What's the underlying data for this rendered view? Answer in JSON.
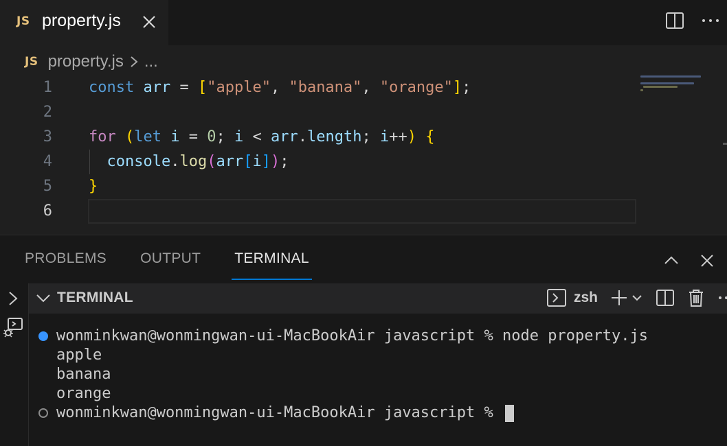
{
  "tab": {
    "badge": "JS",
    "title": "property.js"
  },
  "breadcrumb": {
    "badge": "JS",
    "file": "property.js",
    "more": "..."
  },
  "editor": {
    "line_numbers": [
      "1",
      "2",
      "3",
      "4",
      "5",
      "6"
    ],
    "line1": {
      "kw": "const",
      "var": "arr",
      "eq": " = ",
      "open": "[",
      "s1": "\"apple\"",
      "c1": ", ",
      "s2": "\"banana\"",
      "c2": ", ",
      "s3": "\"orange\"",
      "close": "]",
      "semi": ";"
    },
    "line3": {
      "kw": "for",
      "p_open": "(",
      "let": "let",
      "i1": "i",
      "eq": " = ",
      "zero": "0",
      "semi1": "; ",
      "i2": "i",
      "lt": " < ",
      "arr": "arr",
      "dot": ".",
      "length": "length",
      "semi2": "; ",
      "i3": "i",
      "inc": "++",
      "p_close": ")",
      "brace": "{"
    },
    "line4": {
      "console": "console",
      "dot": ".",
      "log": "log",
      "p_open": "(",
      "arr": "arr",
      "b_open": "[",
      "i": "i",
      "b_close": "]",
      "p_close": ")",
      "semi": ";"
    },
    "line5": {
      "brace": "}"
    }
  },
  "panel": {
    "tabs": [
      {
        "label": "PROBLEMS"
      },
      {
        "label": "OUTPUT"
      },
      {
        "label": "TERMINAL"
      }
    ],
    "terminal_header": "TERMINAL",
    "shell": "zsh"
  },
  "terminal": {
    "command_line": "wonminkwan@wonmingwan-ui-MacBookAir javascript % node property.js",
    "output": [
      "apple",
      "banana",
      "orange"
    ],
    "prompt": "wonminkwan@wonmingwan-ui-MacBookAir javascript % "
  },
  "colors": {
    "accent": "#0078d4",
    "terminal_dot": "#3794ff",
    "js_badge": "#e5c07b"
  }
}
